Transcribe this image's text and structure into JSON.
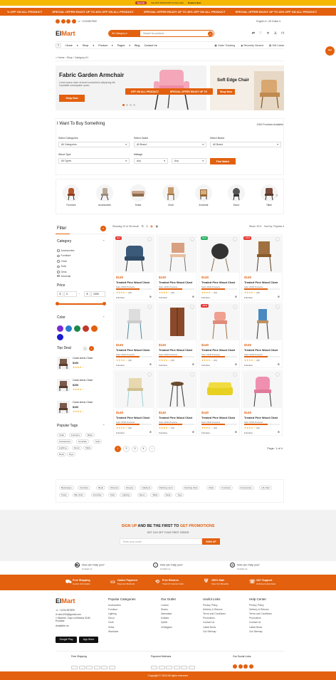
{
  "announce": {
    "pill": "Special",
    "text": "Get 10% DISCOUNT for first order",
    "link": "Explore Now"
  },
  "ticker": [
    "% OFF ON ALL PRODUCT",
    "SPECIAL OFFER ENJOY UP TO 40% OFF ON ALL PRODUCT",
    "SPECIAL OFFER ENJOY UP TO 40% OFF ON ALL PRODUCT",
    "SPECIAL OFFER ENJOY UP TO 40% OFF ON ALL PRODUCT"
  ],
  "topbar": {
    "phone": "+1234567890",
    "lang": "English",
    "currency": "US Dollar"
  },
  "header": {
    "logo_a": "El",
    "logo_b": "Mart",
    "category_btn": "All Category",
    "search_placeholder": "Search for product"
  },
  "nav": {
    "items": [
      "Home",
      "Shop",
      "Product",
      "Pages",
      "Blog",
      "Contact Us"
    ],
    "right": [
      "Order Tracking",
      "Recently Viewed",
      "Gift Cards"
    ]
  },
  "breadcrumb": {
    "home": "Home",
    "shop": "Shop",
    "current": "Category-01"
  },
  "hero": {
    "title": "Fabric Garden Armchair",
    "text": "Lorem ipsum dolor sit amet consectetur adipiscing elit. Cupidatat consequatur quam.",
    "button": "Shop Now",
    "side_title": "Soft Edge Chair",
    "side_button": "Shop Now",
    "ticker_a": "OFF ON ALL PRODUCT",
    "ticker_b": "SPECIAL OFFER ENJOY UP TO"
  },
  "want": {
    "title": "I Want To Buy Something",
    "count": "1000 Products Available",
    "labels": [
      "Select Categories",
      "Select Outlet",
      "Select Brand",
      "Wood Type",
      "Mileage"
    ],
    "values": [
      "All Categories",
      "All Brand",
      "All Brand",
      "All Types",
      "Any",
      "Any"
    ],
    "button": "Find Match"
  },
  "categories": [
    "Furniture",
    "Accessories",
    "Sofas",
    "Chair",
    "Armchair",
    "Decor",
    "Table"
  ],
  "sidebar": {
    "filter": "Filter",
    "category": "Category",
    "cats": [
      "Accessories",
      "Furniture",
      "Chair",
      "Sofa",
      "Desk",
      "Armchair"
    ],
    "price": "Price",
    "price_min": "0",
    "price_max": "1000",
    "currency": "$",
    "color": "Color",
    "colors": [
      "#7b2ad1",
      "#2a7bd1",
      "#1a8a4a",
      "#c0392b",
      "#e2600e",
      "#1a1ad1"
    ],
    "topdeal": "Top Deal",
    "deals": [
      {
        "name": "Cane Arms Chair",
        "price": "$100"
      },
      {
        "name": "Cane Arms Chair",
        "price": "$100"
      },
      {
        "name": "Cane Arms Chair",
        "price": "$100"
      }
    ],
    "tags_title": "Popular Tags",
    "tags": [
      "Chair",
      "Furniture",
      "Beds",
      "Accessories",
      "Armchair",
      "Sofa",
      "Lighting",
      "Decor",
      "Table",
      "Desk",
      "Toys"
    ]
  },
  "products_bar": {
    "showing": "Showing 12 of 36 result",
    "show": "Show: 30",
    "sort": "Sort by: Popular"
  },
  "products": [
    {
      "price": "$140",
      "name": "Treated Pine Wood Chair",
      "sold": "Sold: 20/30 Products",
      "rating": "(18)",
      "cat": "Furniture",
      "badge": "Hot",
      "badge_color": "#e53935",
      "fill": 0.66
    },
    {
      "price": "$140",
      "name": "Treated Pine Wood Chair",
      "sold": "Sold: 20/30 Products",
      "rating": "(18)",
      "cat": "Furniture",
      "badge": "",
      "badge_color": "",
      "fill": 0.66
    },
    {
      "price": "$140",
      "name": "Treated Pine Wood Chair",
      "sold": "Sold: 20/30 Products",
      "rating": "(18)",
      "cat": "Furniture",
      "badge": "New",
      "badge_color": "#27ae60",
      "fill": 0.66
    },
    {
      "price": "$140",
      "name": "Treated Pine Wood Chair",
      "sold": "Sold: 20/30 Products",
      "rating": "(18)",
      "cat": "Furniture",
      "badge": "-15%",
      "badge_color": "#e53935",
      "fill": 0.66
    },
    {
      "price": "$140",
      "name": "Treated Pine Wood Chair",
      "sold": "Sold: 20/30 Products",
      "rating": "(18)",
      "cat": "Furniture",
      "badge": "",
      "badge_color": "",
      "fill": 0.66
    },
    {
      "price": "$140",
      "name": "Treated Pine Wood Chair",
      "sold": "Sold: 20/30 Products",
      "rating": "(18)",
      "cat": "Furniture",
      "badge": "",
      "badge_color": "",
      "fill": 0.66
    },
    {
      "price": "$140",
      "name": "Treated Pine Wood Chair",
      "sold": "Sold: 20/30 Products",
      "rating": "(18)",
      "cat": "Furniture",
      "badge": "-50%",
      "badge_color": "#e53935",
      "fill": 0.66
    },
    {
      "price": "$140",
      "name": "Treated Pine Wood Chair",
      "sold": "Sold: 20/30 Products",
      "rating": "(18)",
      "cat": "Furniture",
      "badge": "",
      "badge_color": "",
      "fill": 0.66
    },
    {
      "price": "$140",
      "name": "Treated Pine Wood Chair",
      "sold": "Sold: 20/30 Products",
      "rating": "(18)",
      "cat": "Furniture",
      "badge": "",
      "badge_color": "",
      "fill": 0.66
    },
    {
      "price": "$140",
      "name": "Treated Pine Wood Chair",
      "sold": "Sold: 20/30 Products",
      "rating": "(18)",
      "cat": "Furniture",
      "badge": "",
      "badge_color": "",
      "fill": 0.66
    },
    {
      "price": "$140",
      "name": "Treated Pine Wood Chair",
      "sold": "Sold: 20/30 Products",
      "rating": "(18)",
      "cat": "Furniture",
      "badge": "",
      "badge_color": "",
      "fill": 0.66
    },
    {
      "price": "$140",
      "name": "Treated Pine Wood Chair",
      "sold": "Sold: 20/30 Products",
      "rating": "(18)",
      "cat": "Furniture",
      "badge": "",
      "badge_color": "",
      "fill": 0.66
    }
  ],
  "pagination": {
    "pages": [
      "1",
      "2",
      "3",
      "4",
      "›"
    ],
    "label": "Page: 1 of 4"
  },
  "tagcloud": [
    "Bookcases",
    "Furniture",
    "Beds",
    "Ottoman",
    "Dresser",
    "Cabinets",
    "Painting count",
    "Rocking chair",
    "Chair",
    "Footstool",
    "Accessories",
    "Lift chair",
    "Poufy",
    "Bar chair",
    "Armchair",
    "Sofa",
    "Lighting",
    "Decor",
    "Table",
    "Desk",
    "Toys"
  ],
  "newsletter": {
    "a": "SIGN UP",
    "b": " AND BE THE FIRST TO ",
    "c": "GET PROMOTIONS",
    "sub": "GET 10% OFF YOUR FIRST ORDER",
    "placeholder": "Enter your email",
    "button": "SIGN UP"
  },
  "help": [
    {
      "q": "How can I help you?",
      "a": "Contact us"
    },
    {
      "q": "How can I help you?",
      "a": "Contact us"
    },
    {
      "q": "How can I help you?",
      "a": "Contact us"
    }
  ],
  "features": [
    {
      "t": "Free Shipping",
      "s": "Center Information"
    },
    {
      "t": "Online Payment",
      "s": "Payment Methods"
    },
    {
      "t": "Free Returns",
      "s": "Track Or Cancle Order"
    },
    {
      "t": "100% Safe",
      "s": "View Our Benefits"
    },
    {
      "t": "24/7 Support",
      "s": "Unlimited Help Desk"
    }
  ],
  "footer": {
    "phone": "+1234 567890",
    "email": "abc1234@gmail.com",
    "address": "Maxime, Capt La Beloha 3160, Ecuador",
    "avail": "Available on:",
    "google": "Google Play",
    "apple": "App Store",
    "col1": {
      "title": "Popular Categories",
      "items": [
        "Accessories",
        "Furniture",
        "Lighting",
        "Decor",
        "Chair",
        "Sofas",
        "Wardrobe"
      ]
    },
    "col2": {
      "title": "Our Outlet",
      "items": [
        "London",
        "Dhaka",
        "Islamabad",
        "Kolkata",
        "Sylhet",
        "Chittagaon"
      ]
    },
    "col3": {
      "title": "Useful Links",
      "items": [
        "Privacy Policy",
        "Delivery & Returns",
        "Terms and Conditions",
        "Promotions",
        "Contact Us",
        "Latest News",
        "Our Sitemap"
      ]
    },
    "col4": {
      "title": "Help Center",
      "items": [
        "Privacy Policy",
        "Delivery & Returns",
        "Terms and Conditions",
        "Promotions",
        "Contact Us",
        "Latest News",
        "Our Sitemap"
      ]
    },
    "shipping": "Free Shipping",
    "payment": "Payment Methods",
    "social": "Our Social Links"
  },
  "copyright": "Copyright © 2024 All rights reserved."
}
